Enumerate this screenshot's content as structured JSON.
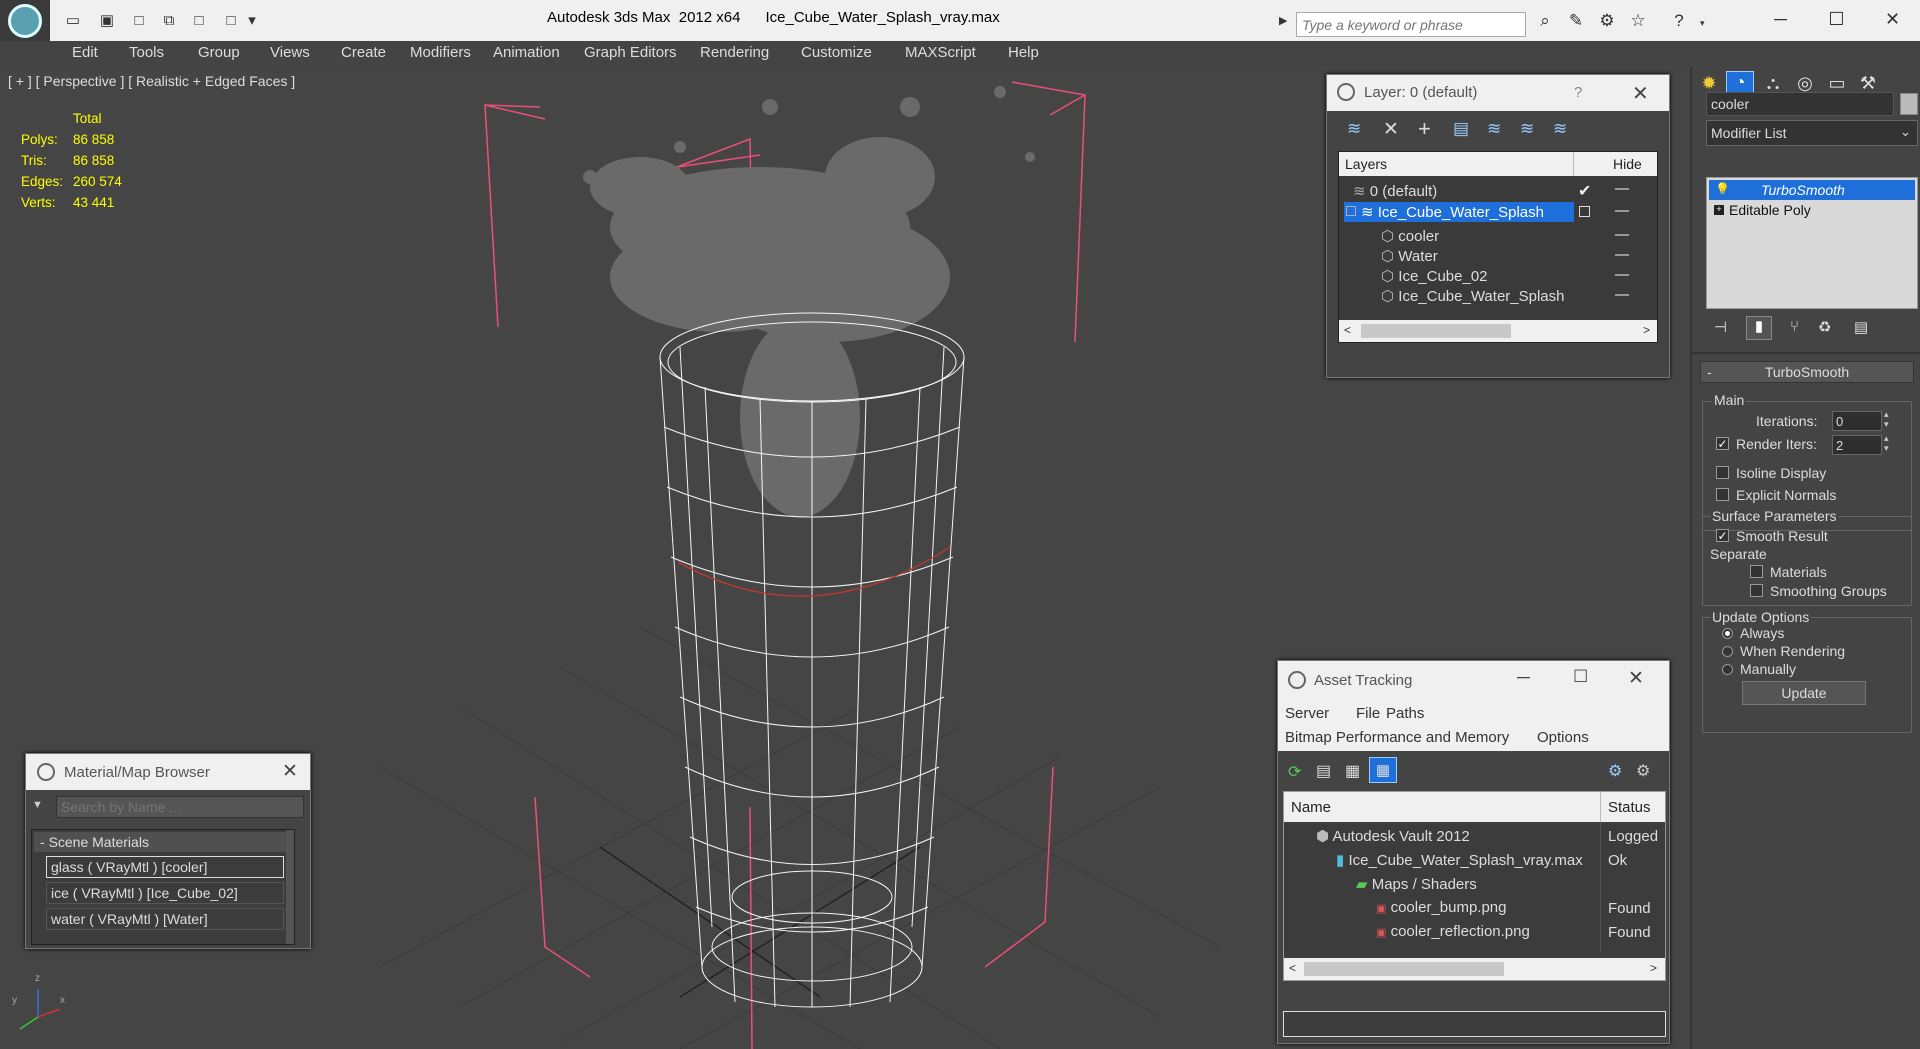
{
  "title": {
    "app": "Autodesk 3ds Max  2012 x64",
    "file": "Ice_Cube_Water_Splash_vray.max"
  },
  "search": {
    "placeholder": "Type a keyword or phrase"
  },
  "menu": [
    "Edit",
    "Tools",
    "Group",
    "Views",
    "Create",
    "Modifiers",
    "Animation",
    "Graph Editors",
    "Rendering",
    "Customize",
    "MAXScript",
    "Help"
  ],
  "viewport": {
    "label": "[ + ] [ Perspective ] [ Realistic + Edged Faces ]",
    "stats": {
      "header": "Total",
      "rows": [
        {
          "label": "Polys:",
          "value": "86 858"
        },
        {
          "label": "Tris:",
          "value": "86 858"
        },
        {
          "label": "Edges:",
          "value": "260 574"
        },
        {
          "label": "Verts:",
          "value": "43 441"
        }
      ]
    },
    "axes": {
      "x": "x",
      "y": "y",
      "z": "z"
    }
  },
  "layers": {
    "title": "Layer: 0 (default)",
    "help": "?",
    "col_layers": "Layers",
    "col_hide": "Hide",
    "rows": [
      {
        "name": "0 (default)"
      },
      {
        "name": "Ice_Cube_Water_Splash"
      },
      {
        "name": "cooler"
      },
      {
        "name": "Water"
      },
      {
        "name": "Ice_Cube_02"
      },
      {
        "name": "Ice_Cube_Water_Splash"
      }
    ]
  },
  "material_browser": {
    "title": "Material/Map Browser",
    "search_placeholder": "Search by Name ...",
    "section": "Scene Materials",
    "items": [
      "glass  ( VRayMtl )  [cooler]",
      "ice  ( VRayMtl )  [Ice_Cube_02]",
      "water  ( VRayMtl )  [Water]"
    ]
  },
  "asset_tracking": {
    "title": "Asset Tracking",
    "menu": [
      "Server",
      "File",
      "Paths"
    ],
    "menu2": [
      "Bitmap Performance and Memory",
      "Options"
    ],
    "col_name": "Name",
    "col_status": "Status",
    "rows": [
      {
        "name": "Autodesk Vault 2012",
        "status": "Logged"
      },
      {
        "name": "Ice_Cube_Water_Splash_vray.max",
        "status": "Ok"
      },
      {
        "name": "Maps / Shaders",
        "status": ""
      },
      {
        "name": "cooler_bump.png",
        "status": "Found"
      },
      {
        "name": "cooler_reflection.png",
        "status": "Found"
      }
    ]
  },
  "command_panel": {
    "object_name": "cooler",
    "modifier_list": "Modifier List",
    "stack": [
      "TurboSmooth",
      "Editable Poly"
    ],
    "rollout_title": "TurboSmooth",
    "main": {
      "label": "Main",
      "iterations_label": "Iterations:",
      "iterations": "0",
      "render_iters_label": "Render Iters:",
      "render_iters": "2",
      "isoline": "Isoline Display",
      "explicit": "Explicit Normals"
    },
    "surface": {
      "label": "Surface Parameters",
      "smooth": "Smooth Result",
      "separate": "Separate",
      "materials": "Materials",
      "smoothing_groups": "Smoothing Groups"
    },
    "update": {
      "label": "Update Options",
      "always": "Always",
      "when_rendering": "When Rendering",
      "manually": "Manually",
      "button": "Update"
    }
  },
  "colors": {
    "accent_blue": "#1e6fd9",
    "stats_yellow": "#ffff00",
    "bbox_pink": "#e8507a"
  }
}
